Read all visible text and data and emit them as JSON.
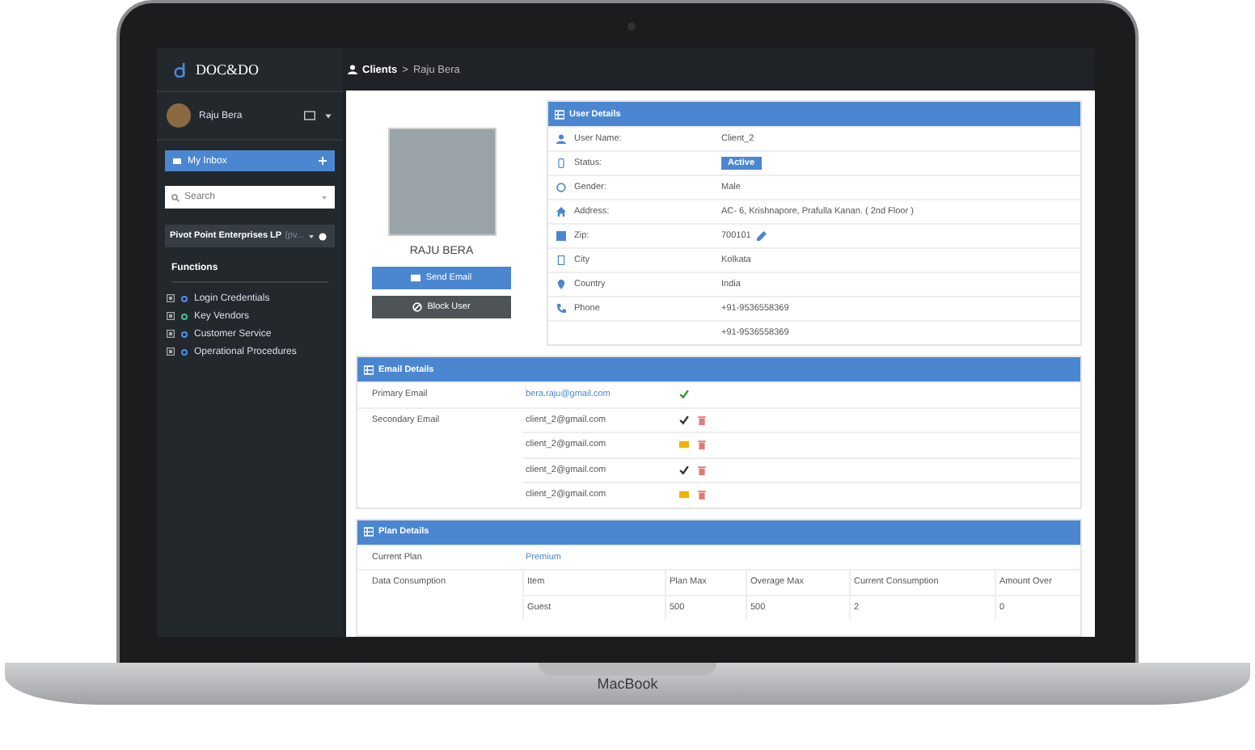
{
  "device": {
    "label": "MacBook"
  },
  "sidebar": {
    "logo": "DOC&DO",
    "user": "Raju Bera",
    "inbox": "My Inbox",
    "search": {
      "placeholder": "Search"
    },
    "company": "Pivot Point Enterprises LP",
    "company_suffix": "(pv...",
    "section": "Functions",
    "items": [
      {
        "label": "Login Credentials",
        "color": "#4a90e2"
      },
      {
        "label": "Key Vendors",
        "color": "#3fbf9f"
      },
      {
        "label": "Customer Service",
        "color": "#4a90e2"
      },
      {
        "label": "Operational Procedures",
        "color": "#4a90e2"
      }
    ]
  },
  "breadcrumb": {
    "section": "Clients",
    "separator": ">",
    "current": "Raju Bera"
  },
  "profile": {
    "name": "RAJU BERA",
    "buttons": [
      {
        "label": "Send Email",
        "kind": "email"
      },
      {
        "label": "Block User",
        "kind": "block"
      }
    ]
  },
  "user_details": {
    "title": "User Details",
    "rows": [
      {
        "label": "User Name:",
        "value": "Client_2"
      },
      {
        "label": "Status:",
        "value": "Active",
        "kind": "badge"
      },
      {
        "label": "Gender:",
        "value": "Male"
      },
      {
        "label": "Address:",
        "value": "AC- 6, Krishnapore, Prafulla Kanan. ( 2nd Floor )"
      },
      {
        "label": "Zip:",
        "value": "700101",
        "kind": "editable"
      },
      {
        "label": "City",
        "value": "Kolkata"
      },
      {
        "label": "Country",
        "value": "India"
      },
      {
        "label": "Phone",
        "value": "+91-9536558369"
      },
      {
        "value": "+91-9536558369"
      }
    ]
  },
  "email_details": {
    "title": "Email Details",
    "primary_label": "Primary Email",
    "primary": {
      "email": "bera.raju@gmail.com",
      "kind": "verified"
    },
    "secondary_label": "Secondary Email",
    "secondary": [
      {
        "email": "client_2@gmail.com",
        "kind": "verified"
      },
      {
        "email": "client_2@gmail.com",
        "kind": "pending"
      },
      {
        "email": "client_2@gmail.com",
        "kind": "verified"
      },
      {
        "email": "client_2@gmail.com",
        "kind": "pending"
      }
    ]
  },
  "plan_details": {
    "title": "Plan Details",
    "plan_label": "Current Plan",
    "plan": "Premium",
    "consumption_label": "Data Consumption",
    "columns": [
      "Item",
      "Plan Max",
      "Overage Max",
      "Current Consumption",
      "Amount Over"
    ],
    "rows": [
      [
        "Guest",
        "500",
        "500",
        "2",
        "0"
      ]
    ]
  }
}
